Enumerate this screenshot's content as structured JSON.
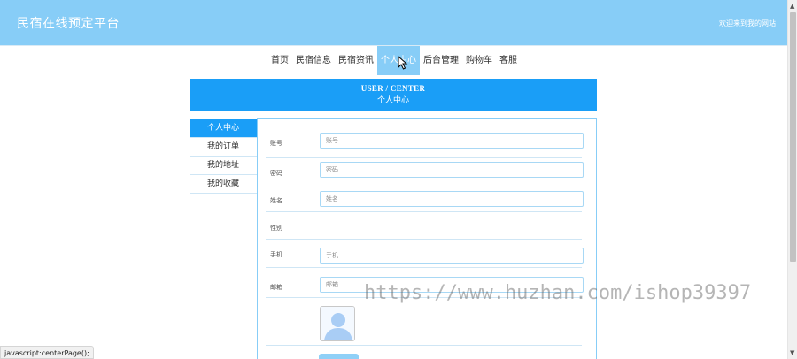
{
  "header": {
    "site_title": "民宿在线预定平台",
    "welcome": "欢迎来到我的网站"
  },
  "nav": {
    "items": [
      {
        "label": "首页"
      },
      {
        "label": "民宿信息"
      },
      {
        "label": "民宿资讯"
      },
      {
        "label": "个人中心",
        "active": true
      },
      {
        "label": "后台管理"
      },
      {
        "label": "购物车"
      },
      {
        "label": "客服"
      }
    ]
  },
  "banner": {
    "title_en": "USER / CENTER",
    "title_cn": "个人中心"
  },
  "sidebar": {
    "items": [
      {
        "label": "个人中心",
        "active": true
      },
      {
        "label": "我的订单"
      },
      {
        "label": "我的地址"
      },
      {
        "label": "我的收藏"
      }
    ]
  },
  "form": {
    "account": {
      "label": "账号",
      "placeholder": "账号"
    },
    "password": {
      "label": "密码",
      "placeholder": "密码"
    },
    "name": {
      "label": "姓名",
      "placeholder": "姓名"
    },
    "gender": {
      "label": "性别"
    },
    "phone": {
      "label": "手机",
      "placeholder": "手机"
    },
    "email": {
      "label": "邮箱",
      "placeholder": "邮箱"
    }
  },
  "statusbar": {
    "text": "javascript:centerPage();"
  },
  "watermark": {
    "text": "https://www.huzhan.com/ishop39397"
  },
  "colors": {
    "header_bg": "#87cdf7",
    "accent": "#1a9ef7"
  }
}
